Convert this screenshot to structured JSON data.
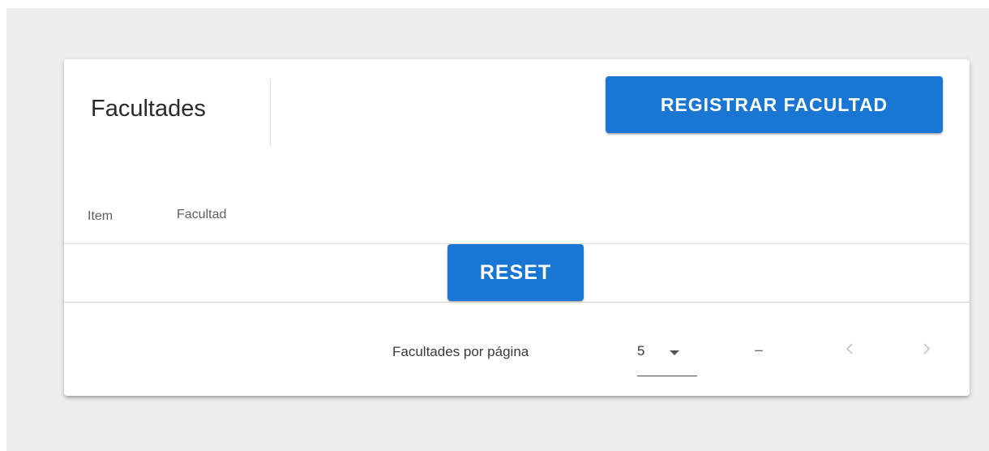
{
  "card": {
    "title": "Facultades",
    "register_button_label": "REGISTRAR FACULTAD"
  },
  "table": {
    "headers": [
      "Item",
      "Facultad"
    ],
    "reset_button_label": "RESET"
  },
  "footer": {
    "rows_per_page_label": "Facultades por página",
    "rows_per_page_value": "5",
    "page_range": "–",
    "prev_icon": "chevron-left-icon",
    "next_icon": "chevron-right-icon"
  },
  "colors": {
    "primary": "#1976d2",
    "background": "#eeeeee"
  }
}
